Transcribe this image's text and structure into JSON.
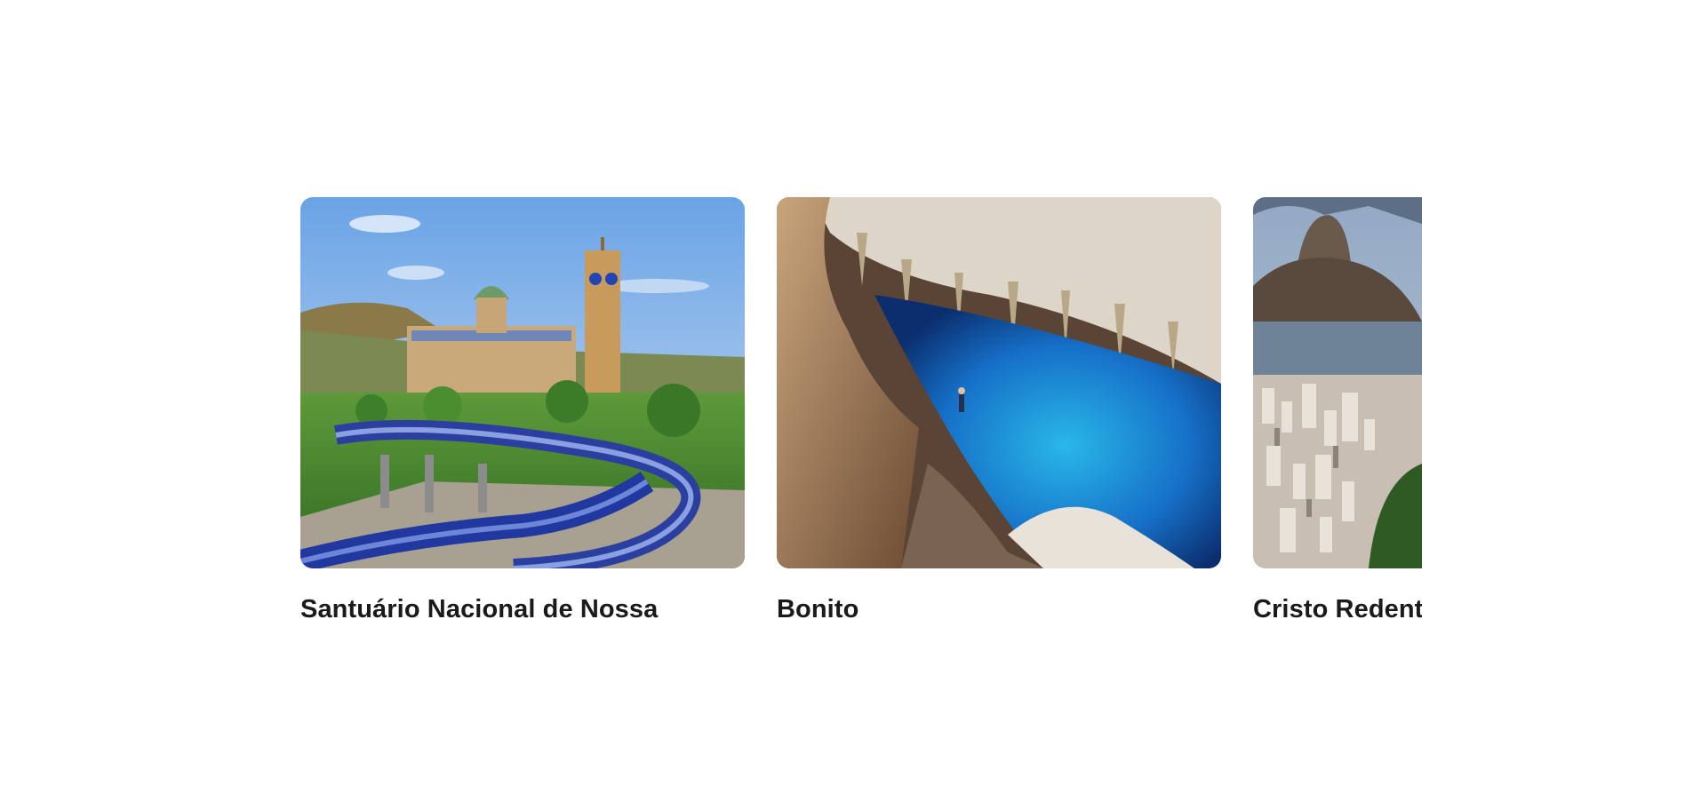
{
  "carousel": {
    "cards": [
      {
        "title": "Santuário Nacional de Nossa",
        "image": "basilica-aparecida-photo"
      },
      {
        "title": "Bonito",
        "image": "blue-lake-cave-photo"
      },
      {
        "title": "Cristo Redentor",
        "image": "rio-sugarloaf-photo"
      }
    ]
  }
}
